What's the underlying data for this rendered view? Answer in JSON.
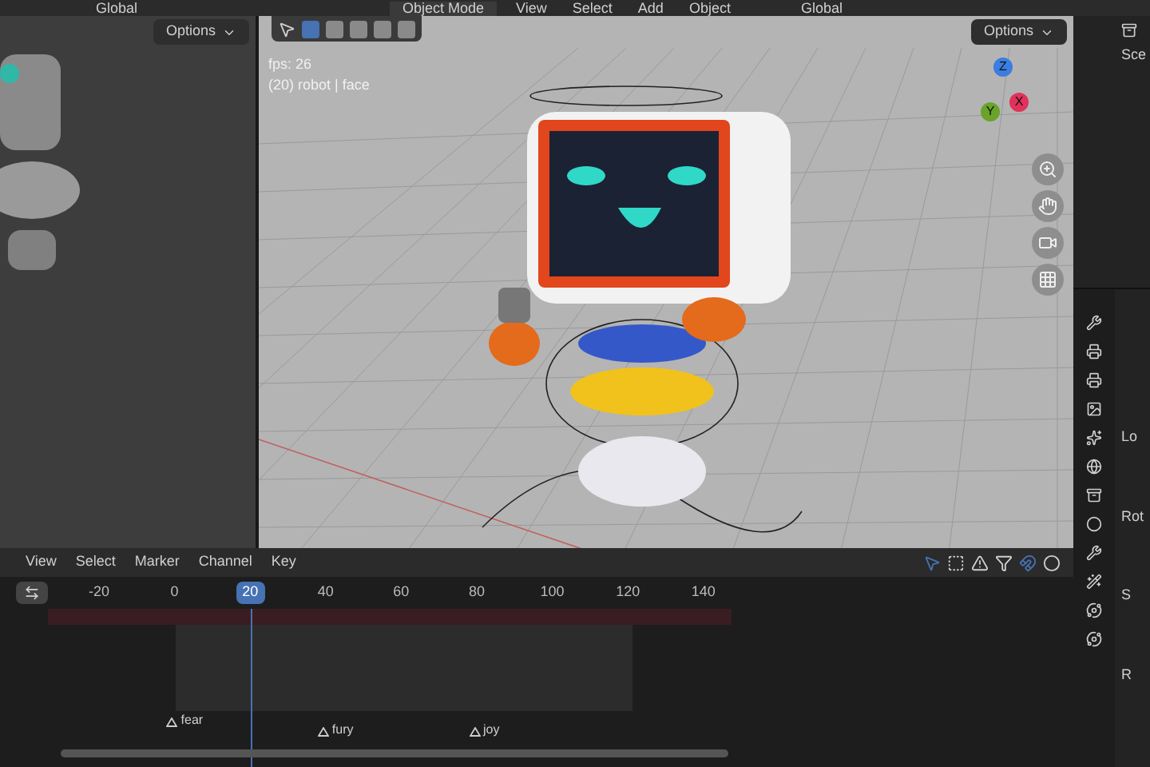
{
  "header": {
    "left_items": [
      "Global"
    ],
    "mode": "Object Mode",
    "menus": [
      "View",
      "Select",
      "Add",
      "Object"
    ],
    "orientation": "Global"
  },
  "left_viewport": {
    "options": "Options"
  },
  "viewport": {
    "options": "Options",
    "select_modes": [
      {
        "selected": true
      },
      {
        "selected": false
      },
      {
        "selected": false
      },
      {
        "selected": false
      },
      {
        "selected": false
      }
    ],
    "fps": "fps: 26",
    "object_info": "(20) robot | face",
    "axes": [
      {
        "label": "Z",
        "color": "#3b7de0"
      },
      {
        "label": "Y",
        "color": "#6aa32a"
      },
      {
        "label": "X",
        "color": "#e0325a"
      }
    ]
  },
  "timeline": {
    "menus": [
      "View",
      "Select",
      "Marker",
      "Channel",
      "Key"
    ],
    "ticks": [
      {
        "label": "-20",
        "selected": false
      },
      {
        "label": "0",
        "selected": false
      },
      {
        "label": "20",
        "selected": true
      },
      {
        "label": "40",
        "selected": false
      },
      {
        "label": "60",
        "selected": false
      },
      {
        "label": "80",
        "selected": false
      },
      {
        "label": "100",
        "selected": false
      },
      {
        "label": "120",
        "selected": false
      },
      {
        "label": "140",
        "selected": false
      }
    ],
    "markers": [
      {
        "label": "fear"
      },
      {
        "label": "fury"
      },
      {
        "label": "joy"
      }
    ]
  },
  "outliner": {
    "items": [
      "Sce"
    ]
  },
  "properties": {
    "labels": [
      "Lo",
      "Rot",
      "S",
      "R"
    ]
  }
}
